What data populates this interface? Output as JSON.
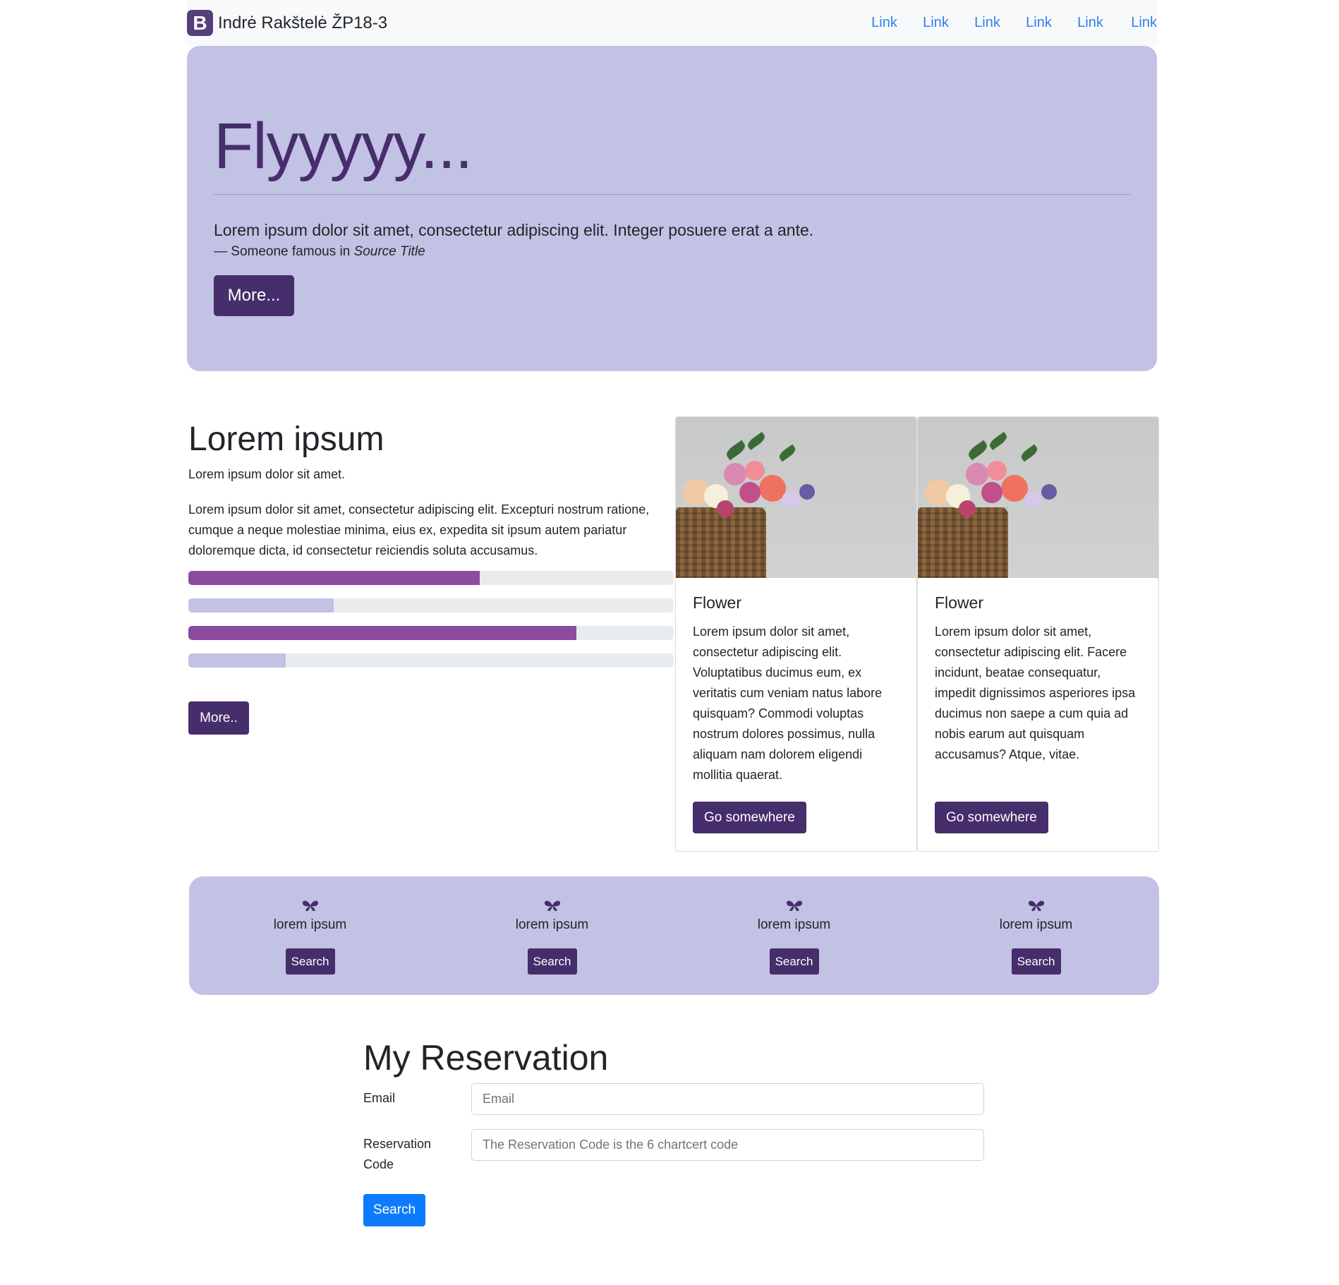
{
  "navbar": {
    "logo_letter": "B",
    "brand": "Indrė Rakštelė ŽP18-3",
    "links": [
      "Link",
      "Link",
      "Link",
      "Link",
      "Link",
      "Link"
    ]
  },
  "hero": {
    "title": "Flyyyyy...",
    "quote": "Lorem ipsum dolor sit amet, consectetur adipiscing elit. Integer posuere erat a ante.",
    "cite_prefix": "— Someone famous in",
    "cite_source": "Source Title",
    "button": "More..."
  },
  "about": {
    "title": "Lorem ipsum",
    "subtitle": "Lorem ipsum dolor sit amet.",
    "paragraph": "Lorem ipsum dolor sit amet, consectetur adipiscing elit. Excepturi nostrum ratione, cumque a neque molestiae minima, eius ex, expedita sit ipsum autem pariatur doloremque dicta, id consectetur reiciendis soluta accusamus.",
    "progress": [
      {
        "percent": 60,
        "color": "#8b4ca0"
      },
      {
        "percent": 30,
        "color": "#c2c2e4"
      },
      {
        "percent": 80,
        "color": "#8b4ca0"
      },
      {
        "percent": 20,
        "color": "#c2c2e4"
      }
    ],
    "button": "More.."
  },
  "cards": [
    {
      "title": "Flower",
      "text": "Lorem ipsum dolor sit amet, consectetur adipiscing elit. Voluptatibus ducimus eum, ex veritatis cum veniam natus labore quisquam? Commodi voluptas nostrum dolores possimus, nulla aliquam nam dolorem eligendi mollitia quaerat.",
      "button": "Go somewhere"
    },
    {
      "title": "Flower",
      "text": "Lorem ipsum dolor sit amet, consectetur adipiscing elit. Facere incidunt, beatae consequatur, impedit dignissimos asperiores ipsa ducimus non saepe a cum quia ad nobis earum aut quisquam accusamus? Atque, vitae.",
      "button": "Go somewhere"
    }
  ],
  "features": [
    {
      "icon": "butterfly-icon",
      "label": "lorem ipsum",
      "button": "Search"
    },
    {
      "icon": "butterfly-icon",
      "label": "lorem ipsum",
      "button": "Search"
    },
    {
      "icon": "butterfly-icon",
      "label": "lorem ipsum",
      "button": "Search"
    },
    {
      "icon": "butterfly-icon",
      "label": "lorem ipsum",
      "button": "Search"
    }
  ],
  "reservation": {
    "title": "My Reservation",
    "email_label": "Email",
    "email_placeholder": "Email",
    "code_label": "Reservation Code",
    "code_placeholder": "The Reservation Code is the 6 chartcert code",
    "button": "Search"
  },
  "colors": {
    "primary": "#462d6b",
    "accent_light": "#c2c2e4",
    "progress_purple": "#8b4ca0",
    "link": "#2f7ff0",
    "submit_blue": "#0d7bff"
  }
}
